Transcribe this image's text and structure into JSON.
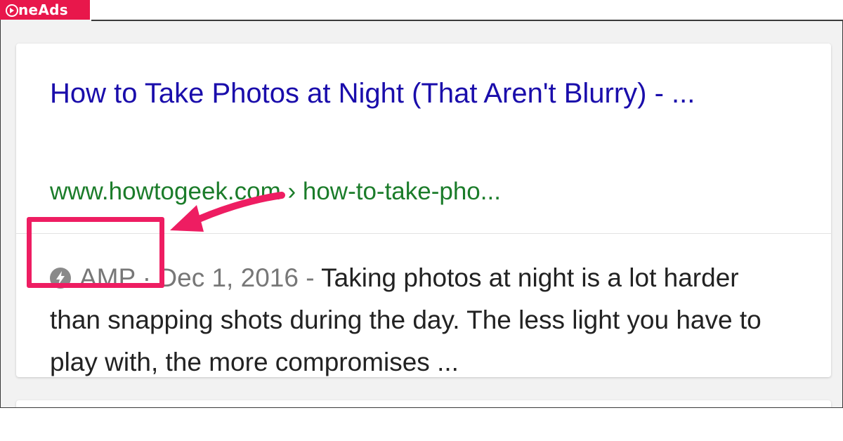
{
  "watermark": {
    "text": "neAds",
    "brand_color": "#e8174b"
  },
  "result": {
    "title": "How to Take Photos at Night (That Aren't Blurry) - ...",
    "url": "www.howtogeek.com › how-to-take-pho...",
    "amp_icon": "lightning-bolt-icon",
    "amp_label": "AMP",
    "separator": "·",
    "date": "Dec 1, 2016",
    "dash": "-",
    "snippet": "Taking photos at night is a lot harder than snapping shots during the day. The less light you have to play with, the more compromises  ..."
  },
  "annotation": {
    "highlight_color": "#ee1d62",
    "arrow_icon": "pointer-arrow-icon"
  },
  "colors": {
    "title_link": "#1a0dab",
    "url_green": "#1b7c2a",
    "meta_gray": "#777777"
  }
}
